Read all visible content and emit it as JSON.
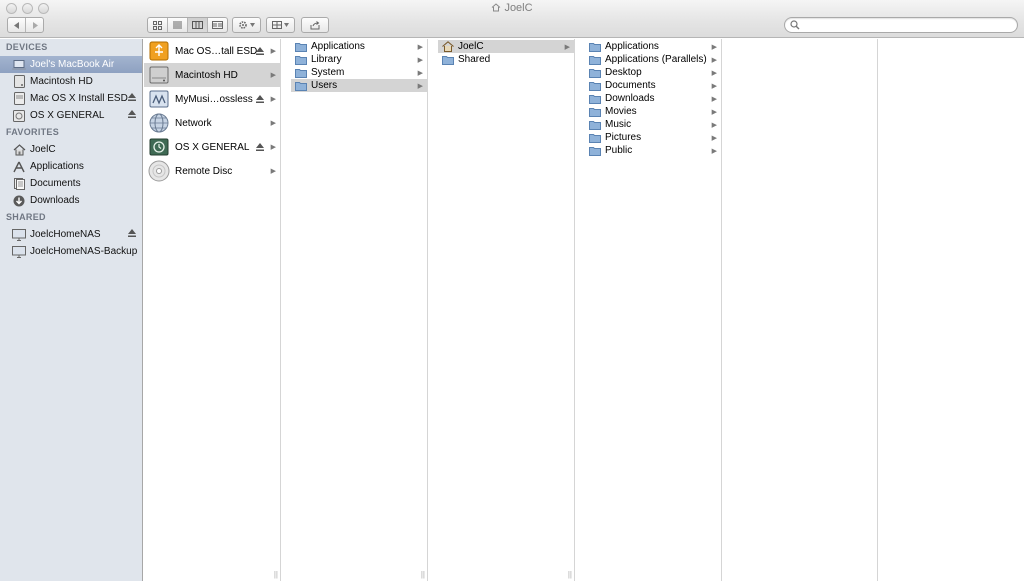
{
  "window": {
    "title": "JoelC"
  },
  "search": {
    "placeholder": ""
  },
  "sidebar": {
    "devices_header": "DEVICES",
    "devices": [
      {
        "label": "Joel's MacBook Air",
        "icon": "laptop-icon",
        "selected": true
      },
      {
        "label": "Macintosh HD",
        "icon": "hard-drive-icon"
      },
      {
        "label": "Mac OS X Install ESD",
        "icon": "disk-image-icon",
        "eject": true
      },
      {
        "label": "OS X GENERAL",
        "icon": "drive-icon",
        "eject": true
      }
    ],
    "favorites_header": "FAVORITES",
    "favorites": [
      {
        "label": "JoelC",
        "icon": "home-icon"
      },
      {
        "label": "Applications",
        "icon": "applications-icon"
      },
      {
        "label": "Documents",
        "icon": "documents-icon"
      },
      {
        "label": "Downloads",
        "icon": "downloads-icon"
      }
    ],
    "shared_header": "SHARED",
    "shared": [
      {
        "label": "JoelcHomeNAS",
        "icon": "display-icon",
        "eject": true
      },
      {
        "label": "JoelcHomeNAS-Backup",
        "icon": "display-icon"
      }
    ]
  },
  "columns": {
    "volumes": [
      {
        "label": "Mac OS…tall ESD",
        "icon": "usb-drive-icon"
      },
      {
        "label": "Macintosh HD",
        "icon": "hard-drive-icon",
        "selected": true
      },
      {
        "label": "MyMusi…ossless",
        "icon": "network-share-icon"
      },
      {
        "label": "Network",
        "icon": "network-globe-icon"
      },
      {
        "label": "OS X GENERAL",
        "icon": "time-machine-icon"
      },
      {
        "label": "Remote Disc",
        "icon": "disc-icon"
      }
    ],
    "macintosh_hd": [
      {
        "label": "Applications"
      },
      {
        "label": "Library"
      },
      {
        "label": "System"
      },
      {
        "label": "Users",
        "selected": true
      }
    ],
    "users": [
      {
        "label": "JoelC",
        "selected": true
      },
      {
        "label": "Shared"
      }
    ],
    "joelc": [
      {
        "label": "Applications"
      },
      {
        "label": "Applications (Parallels)"
      },
      {
        "label": "Desktop"
      },
      {
        "label": "Documents"
      },
      {
        "label": "Downloads"
      },
      {
        "label": "Movies"
      },
      {
        "label": "Music"
      },
      {
        "label": "Pictures"
      },
      {
        "label": "Public"
      }
    ]
  },
  "colors": {
    "sidebar_bg": "#e0e5ec",
    "sidebar_selected": "#94a6c5",
    "column_selected": "#d4d4d4",
    "folder": "#8fb2d9"
  }
}
